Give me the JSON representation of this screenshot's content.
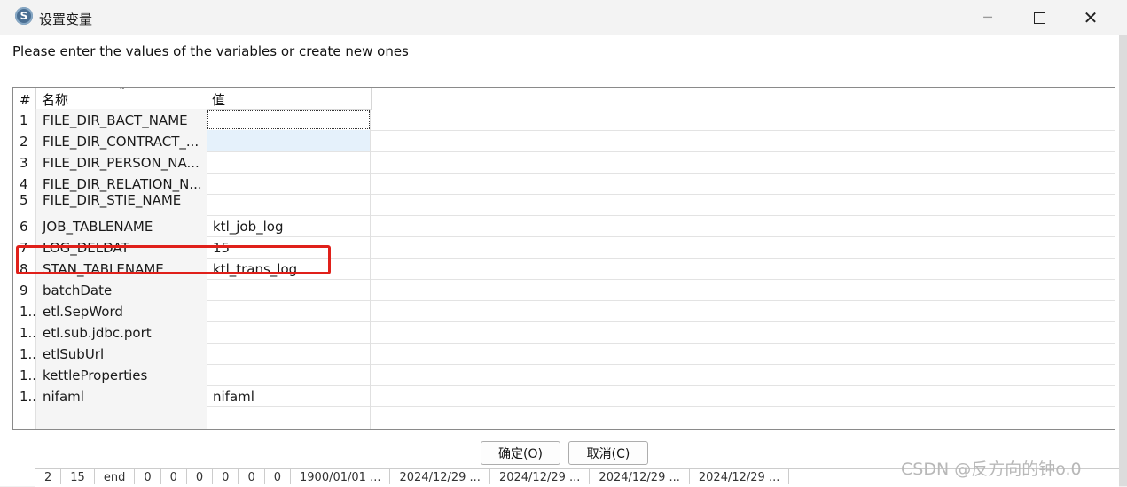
{
  "window": {
    "title": "设置变量",
    "app_icon_glyph": "S",
    "minimize_icon": "─",
    "close_icon": "✕"
  },
  "prompt": "Please enter the values of the variables or create new ones",
  "table": {
    "headers": {
      "num": "#",
      "name": "名称",
      "value": "值",
      "sort_indicator": "^"
    },
    "rows": [
      {
        "num": "1",
        "name": "FILE_DIR_BACT_NAME",
        "value": ""
      },
      {
        "num": "2",
        "name": "FILE_DIR_CONTRACT_...",
        "value": ""
      },
      {
        "num": "3",
        "name": "FILE_DIR_PERSON_NA...",
        "value": ""
      },
      {
        "num": "4",
        "name": "FILE_DIR_RELATION_N...",
        "value": ""
      },
      {
        "num": "5",
        "name": "FILE_DIR_STIE_NAME",
        "value": ""
      },
      {
        "num": "6",
        "name": "JOB_TABLENAME",
        "value": "ktl_job_log"
      },
      {
        "num": "7",
        "name": "LOG_DELDAT",
        "value": "15"
      },
      {
        "num": "8",
        "name": "STAN_TABLENAME",
        "value": "ktl_trans_log"
      },
      {
        "num": "9",
        "name": "batchDate",
        "value": ""
      },
      {
        "num": "1..",
        "name": "etl.SepWord",
        "value": ""
      },
      {
        "num": "1..",
        "name": "etl.sub.jdbc.port",
        "value": ""
      },
      {
        "num": "1..",
        "name": "etlSubUrl",
        "value": ""
      },
      {
        "num": "1..",
        "name": "kettleProperties",
        "value": ""
      },
      {
        "num": "1..",
        "name": "nifaml",
        "value": "nifaml"
      }
    ]
  },
  "buttons": {
    "ok": "确定(O)",
    "cancel": "取消(C)"
  },
  "background_strip": [
    "2",
    "15",
    "end",
    "0",
    "0",
    "0",
    "0",
    "0",
    "0",
    "1900/01/01 ...",
    "2024/12/29 ...",
    "2024/12/29 ...",
    "2024/12/29 ...",
    "2024/12/29 ..."
  ],
  "watermark": "CSDN @反方向的钟o.0",
  "colors": {
    "highlight_border": "#e0201a",
    "selected_cell": "#e5f1fb"
  }
}
